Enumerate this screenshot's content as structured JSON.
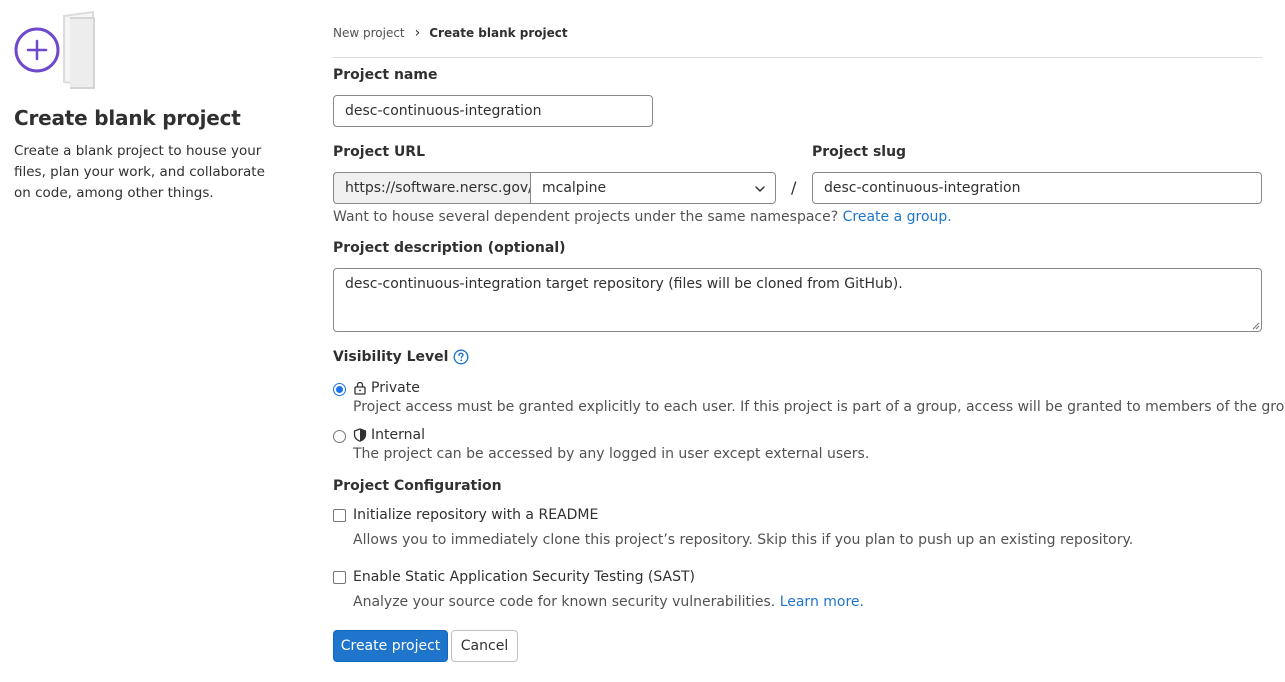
{
  "sidebar": {
    "title": "Create blank project",
    "description": "Create a blank project to house your files, plan your work, and collaborate on code, among other things."
  },
  "breadcrumb": {
    "parent": "New project",
    "current": "Create blank project"
  },
  "form": {
    "project_name": {
      "label": "Project name",
      "value": "desc-continuous-integration"
    },
    "project_url": {
      "label": "Project URL",
      "prefix": "https://software.nersc.gov/",
      "namespace": "mcalpine"
    },
    "slug_separator": "/",
    "project_slug": {
      "label": "Project slug",
      "value": "desc-continuous-integration"
    },
    "group_help": {
      "text": "Want to house several dependent projects under the same namespace?",
      "link": "Create a group."
    },
    "description": {
      "label": "Project description (optional)",
      "value": "desc-continuous-integration target repository (files will be cloned from GitHub)."
    },
    "visibility": {
      "label": "Visibility Level",
      "options": [
        {
          "title": "Private",
          "description": "Project access must be granted explicitly to each user. If this project is part of a group, access will be granted to members of the group.",
          "selected": true,
          "icon": "lock-icon"
        },
        {
          "title": "Internal",
          "description": "The project can be accessed by any logged in user except external users.",
          "selected": false,
          "icon": "shield-icon"
        }
      ]
    },
    "configuration": {
      "label": "Project Configuration",
      "readme": {
        "label": "Initialize repository with a README",
        "help": "Allows you to immediately clone this project’s repository. Skip this if you plan to push up an existing repository.",
        "checked": false
      },
      "sast": {
        "label": "Enable Static Application Security Testing (SAST)",
        "help": "Analyze your source code for known security vulnerabilities.",
        "link": "Learn more.",
        "checked": false
      }
    }
  },
  "actions": {
    "create": "Create project",
    "cancel": "Cancel"
  },
  "colors": {
    "primary": "#1f75cb",
    "illustration_purple": "#6e49cb",
    "text": "#303030"
  }
}
